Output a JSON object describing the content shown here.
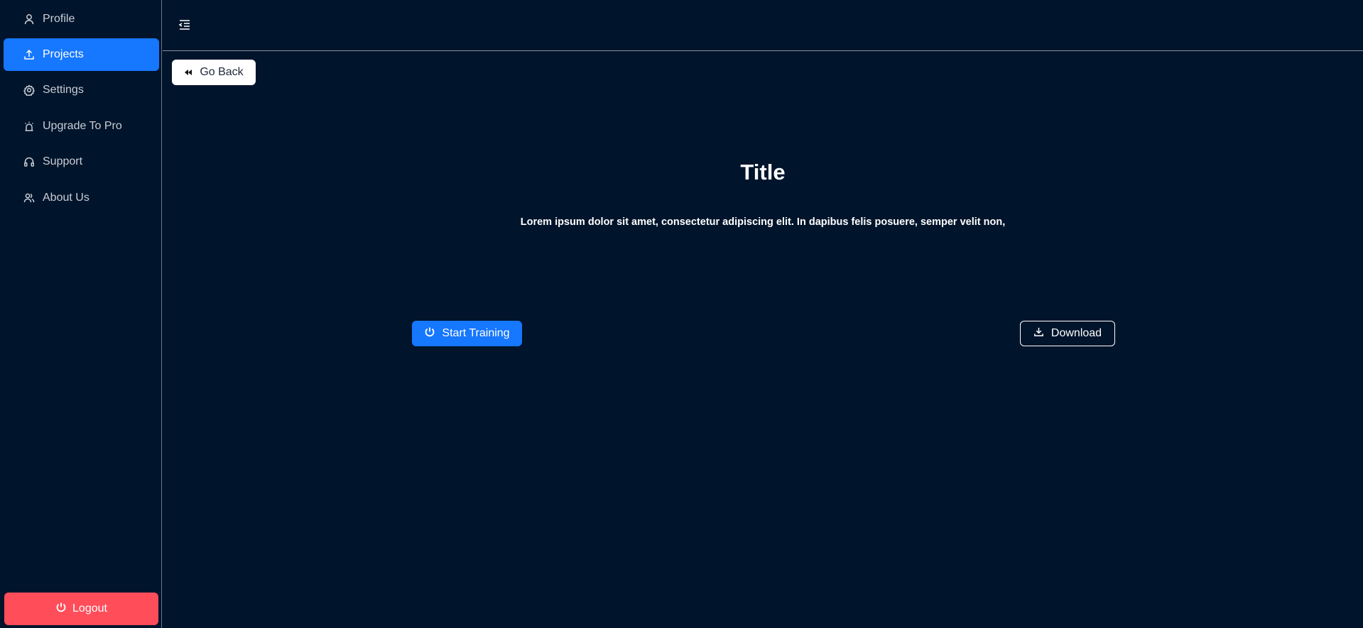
{
  "sidebar": {
    "items": [
      {
        "label": "Profile",
        "icon": "user-icon",
        "active": false
      },
      {
        "label": "Projects",
        "icon": "upload-icon",
        "active": true
      },
      {
        "label": "Settings",
        "icon": "gear-icon",
        "active": false
      },
      {
        "label": "Upgrade To Pro",
        "icon": "alarm-icon",
        "active": false
      },
      {
        "label": "Support",
        "icon": "headphones-icon",
        "active": false
      },
      {
        "label": "About Us",
        "icon": "team-icon",
        "active": false
      }
    ],
    "logout_label": "Logout"
  },
  "header": {
    "menu_icon": "menu-fold-icon"
  },
  "main": {
    "go_back_label": "Go Back",
    "title": "Title",
    "description": "Lorem ipsum dolor sit amet, consectetur adipiscing elit. In dapibus felis posuere, semper velit non,",
    "start_training_label": "Start Training",
    "download_label": "Download"
  },
  "colors": {
    "background": "#00142b",
    "accent": "#1677ff",
    "danger": "#ff4d5a"
  }
}
